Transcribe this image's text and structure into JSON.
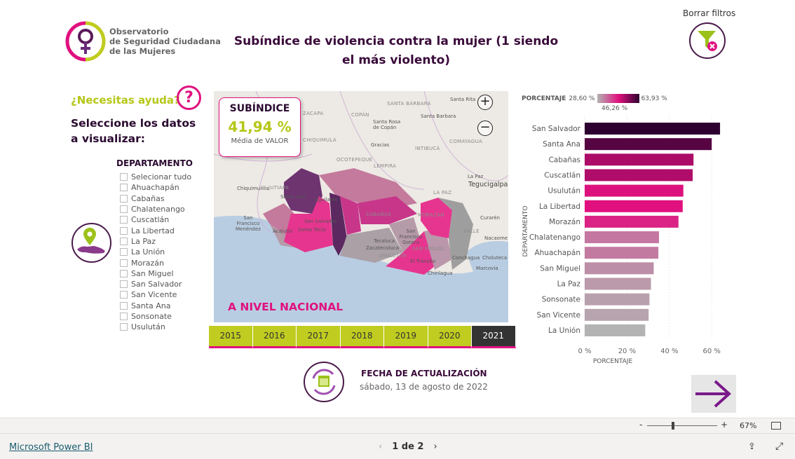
{
  "header": {
    "logo_text": [
      "Observatorio",
      "de Seguridad Ciudadana",
      "de las Mujeres"
    ],
    "title": "Subíndice de violencia contra la mujer  (1 siendo el más violento)",
    "clear_filters_label": "Borrar filtros"
  },
  "sidebar": {
    "help_label": "¿Necesitas ayuda?",
    "help_icon": "?",
    "select_title": "Seleccione los datos a visualizar:",
    "slicer_title": "DEPARTAMENTO",
    "items": [
      "Selecionar tudo",
      "Ahuachapán",
      "Cabañas",
      "Chalatenango",
      "Cuscatlán",
      "La Libertad",
      "La Paz",
      "La Unión",
      "Morazán",
      "San Miguel",
      "San Salvador",
      "San Vicente",
      "Santa Ana",
      "Sonsonate",
      "Usulután"
    ]
  },
  "kpi": {
    "title": "SUBÍNDICE",
    "value": "41,94 %",
    "subtitle": "Média de VALOR"
  },
  "map": {
    "caption": "A NIVEL NACIONAL",
    "zoom_in": "+",
    "zoom_out": "−",
    "labels": [
      "ZACAPA",
      "COPÁN",
      "SANTA BÁRBARA",
      "Santa Rita",
      "Santa Barbara",
      "Santa Rosa de Copán",
      "CHIQUIMULA",
      "Gracias",
      "INTIBUCÁ",
      "COMAYAGUA",
      "OCOTEPEQUE",
      "LEMPIRA",
      "Chiquimulilla",
      "JUTIAPA",
      "Tegucigalpa",
      "La Paz",
      "LA PAZ",
      "Santa Ana",
      "Aguilares",
      "San Salvador",
      "Santa Tecla",
      "Acajutla",
      "San Francisco Menéndez",
      "CABAÑAS",
      "MORAZÁN",
      "San Francisco Gotera",
      "Tecoluca",
      "Zacatecoluca",
      "USULUTÁN",
      "SAN MIGUEL",
      "El Tránsito",
      "Chirilagua",
      "Conchagua",
      "Choluteca",
      "Marcovia",
      "Nacaome",
      "VALLE",
      "Curarén"
    ]
  },
  "years": {
    "items": [
      "2015",
      "2016",
      "2017",
      "2018",
      "2019",
      "2020",
      "2021"
    ],
    "selected": "2021"
  },
  "chart_data": {
    "type": "bar",
    "orientation": "horizontal",
    "xlabel": "PORCENTAJE",
    "ylabel": "DEPARTAMENTO",
    "categories": [
      "San Salvador",
      "Santa Ana",
      "Cabañas",
      "Cuscatlán",
      "Usulután",
      "La Libertad",
      "Morazán",
      "Chalatenango",
      "Ahuachapán",
      "San Miguel",
      "La Paz",
      "Sonsonate",
      "San Vicente",
      "La Unión"
    ],
    "values": [
      63.93,
      60.0,
      51.4,
      51.0,
      46.6,
      46.3,
      44.3,
      35.1,
      34.8,
      32.6,
      31.3,
      30.6,
      30.2,
      28.6
    ],
    "xlim": [
      0,
      65
    ],
    "xticks": [
      "0 %",
      "20 %",
      "40 %",
      "60 %"
    ],
    "xtick_values": [
      0,
      20,
      40,
      60
    ],
    "grid": true,
    "legend": {
      "title": "PORCENTAJE",
      "min": "28,60 %",
      "mid": "46,26 %",
      "max": "63,93 %",
      "colors": [
        "#b3b3b3",
        "#e0117f",
        "#2e0030"
      ]
    }
  },
  "update": {
    "title": "FECHA DE ACTUALIZACIÓN",
    "date": "sábado, 13 de agosto de 2022"
  },
  "zoom": {
    "minus": "-",
    "plus": "+",
    "level": "67%",
    "slider_fraction": 0.35
  },
  "footer": {
    "brand": "Microsoft Power BI",
    "page": "1 de 2"
  },
  "colors": {
    "pink": "#e0117f",
    "lime": "#c0cc1f",
    "purple": "#3a0a3a"
  }
}
